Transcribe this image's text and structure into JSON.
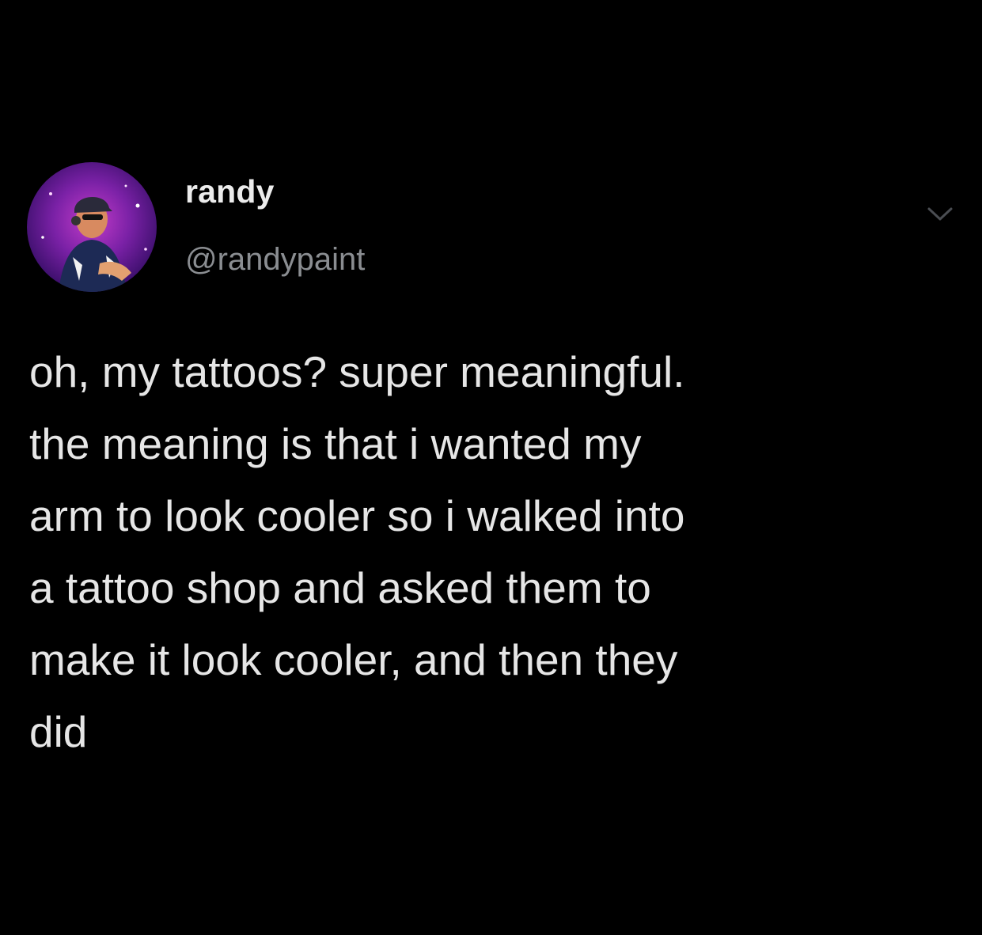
{
  "author": {
    "display_name": "randy",
    "handle": "@randypaint",
    "avatar_icon": "profile-avatar"
  },
  "tweet": {
    "text": "oh, my tattoos? super meaningful.\nthe meaning is that i wanted my\narm to look cooler so i walked into\na tattoo shop and asked them to\nmake it look cooler, and then they\ndid"
  },
  "controls": {
    "menu_icon": "chevron-down-icon"
  },
  "colors": {
    "background": "#000000",
    "text_primary": "#e6e6e6",
    "text_secondary": "#8a8d91"
  }
}
